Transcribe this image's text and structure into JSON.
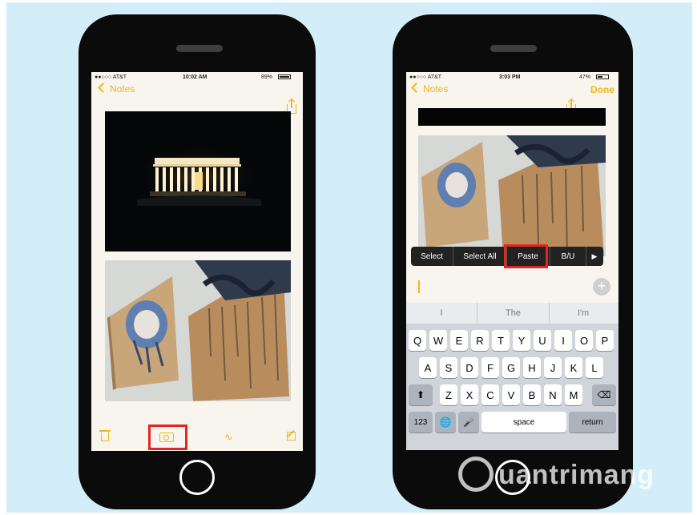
{
  "left_phone": {
    "status": {
      "carrier": "●●○○○ AT&T",
      "time": "10:02 AM",
      "battery": "89%"
    },
    "nav": {
      "back_label": "Notes"
    },
    "photo_1": "lincoln-memorial-night-photo",
    "photo_2": "wall-art-photo",
    "toolbar": {
      "trash": "trash-icon",
      "camera": "camera-icon",
      "sketch": "sketch-icon",
      "compose": "compose-icon"
    }
  },
  "right_phone": {
    "status": {
      "carrier": "●●○○○ AT&T",
      "time": "3:03 PM",
      "battery": "47%"
    },
    "nav": {
      "back_label": "Notes",
      "done_label": "Done"
    },
    "edit_menu": {
      "items": [
        "Select",
        "Select All",
        "Paste",
        "B/U"
      ]
    },
    "keyboard": {
      "suggestions": [
        "I",
        "The",
        "I'm"
      ],
      "row1": [
        "Q",
        "W",
        "E",
        "R",
        "T",
        "Y",
        "U",
        "I",
        "O",
        "P"
      ],
      "row2": [
        "A",
        "S",
        "D",
        "F",
        "G",
        "H",
        "J",
        "K",
        "L"
      ],
      "row3": [
        "Z",
        "X",
        "C",
        "V",
        "B",
        "N",
        "M"
      ],
      "numbers_label": "123",
      "space_label": "space",
      "return_label": "return"
    }
  },
  "watermark": {
    "text": "uantrimang"
  },
  "colors": {
    "accent": "#f2b616",
    "highlight": "#e52521",
    "background": "#d3eef8"
  }
}
